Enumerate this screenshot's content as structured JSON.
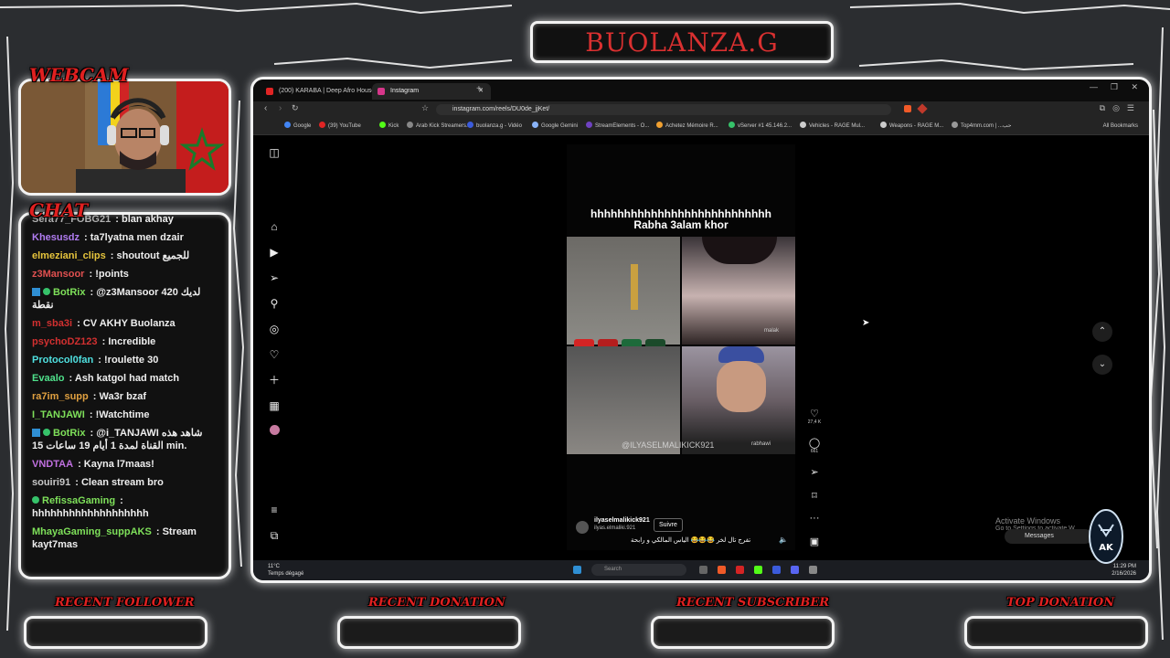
{
  "overlay": {
    "title": "BUOLANZA.G",
    "webcam_label": "WEBCAM",
    "chat_label": "CHAT",
    "bottom_labels": [
      "RECENT FOLLOWER",
      "RECENT DONATION",
      "RECENT SUBSCRIBER",
      "TOP DONATION"
    ]
  },
  "chat": {
    "messages": [
      {
        "user": "Sera77_FOBG21",
        "color": "#b0b0b0",
        "text": "blan akhay"
      },
      {
        "user": "Khesusdz",
        "color": "#b07cf0",
        "text": "ta7lyatna men dzair"
      },
      {
        "user": "elmeziani_clips",
        "color": "#e6c43c",
        "text": "shoutout للجميع"
      },
      {
        "user": "z3Mansoor",
        "color": "#e05050",
        "text": "!points"
      },
      {
        "user": "BotRix",
        "color": "#7ee05a",
        "text": "@z3Mansoor لديك 420 نقطة",
        "bot": true
      },
      {
        "user": "m_sba3i",
        "color": "#d23030",
        "text": "CV AKHY Buolanza"
      },
      {
        "user": "psychoDZ123",
        "color": "#d23030",
        "text": "Incredible"
      },
      {
        "user": "Protocol0fan",
        "color": "#4fe0e0",
        "text": "!roulette 30"
      },
      {
        "user": "Evaalo",
        "color": "#4fe08a",
        "text": "Ash katgol had match"
      },
      {
        "user": "ra7im_supp",
        "color": "#e0a040",
        "text": "Wa3r bzaf"
      },
      {
        "user": "I_TANJAWI",
        "color": "#7ee05a",
        "text": "!Watchtime"
      },
      {
        "user": "BotRix",
        "color": "#7ee05a",
        "text": "@i_TANJAWI شاهد هذه القناة لمدة 1 أيام 19 ساعات 15 min.",
        "bot": true
      },
      {
        "user": "VNDTAA",
        "color": "#c070e0",
        "text": "Kayna l7maas!"
      },
      {
        "user": "souiri91",
        "color": "#c8c8c8",
        "text": "Clean stream bro"
      },
      {
        "user": "RefissaGaming",
        "color": "#7ee05a",
        "text": "hhhhhhhhhhhhhhhhhhh",
        "check": true
      },
      {
        "user": "MhayaGaming_suppAKS",
        "color": "#7ee05a",
        "text": "Stream kayt7mas"
      }
    ]
  },
  "browser": {
    "tabs": [
      {
        "label": "(200) KARABA | Deep Afro House - Y",
        "color": "#e02424"
      },
      {
        "label": "Instagram",
        "color": "#d6368a"
      }
    ],
    "url": "instagram.com/reels/DU0de_jjKet/",
    "bookmarks": [
      {
        "label": "Google",
        "color": "#4285f4"
      },
      {
        "label": "(39) YouTube",
        "color": "#e02424"
      },
      {
        "label": "Kick",
        "color": "#53fc18"
      },
      {
        "label": "Arab Kick Streamers...",
        "color": "#888888"
      },
      {
        "label": "buolanza.g - Vidéo",
        "color": "#3b5bdb"
      },
      {
        "label": "Google Gemini",
        "color": "#8ab4f8"
      },
      {
        "label": "StreamElements - O...",
        "color": "#6f42c1"
      },
      {
        "label": "Achetez Mémoire R...",
        "color": "#f0a030"
      },
      {
        "label": "vServer #1 45.146.2...",
        "color": "#36c26a"
      },
      {
        "label": "Vehicles - RAGE Mul...",
        "color": "#cccccc"
      },
      {
        "label": "Weapons - RAGE M...",
        "color": "#cccccc"
      },
      {
        "label": "Top4mm.com | ...حب",
        "color": "#999999"
      }
    ],
    "all_bookmarks": "All Bookmarks"
  },
  "reel": {
    "caption_line1": "hhhhhhhhhhhhhhhhhhhhhhhhhhh",
    "caption_line2": "Rabha 3alam khor",
    "watermark": "@ILYASELMALIKICK921",
    "tag_malak": "malak",
    "tag_rabhawi": "rabhawi",
    "username": "ilyaselmalikick921",
    "subname": "ilyas.elmaliki.921",
    "follow_label": "Suivre",
    "description": "تفرج تال لخر 😂😂😂 الياس المالكي و رابحة",
    "likes": "27,4 K",
    "comments": "661"
  },
  "page": {
    "activate_title": "Activate Windows",
    "activate_sub": "Go to Settings to activate W",
    "messages_label": "Messages"
  },
  "taskbar": {
    "weather_temp": "11°C",
    "weather_desc": "Temps dégagé",
    "search_placeholder": "Search",
    "time": "11:29 PM",
    "date": "2/16/2026"
  }
}
